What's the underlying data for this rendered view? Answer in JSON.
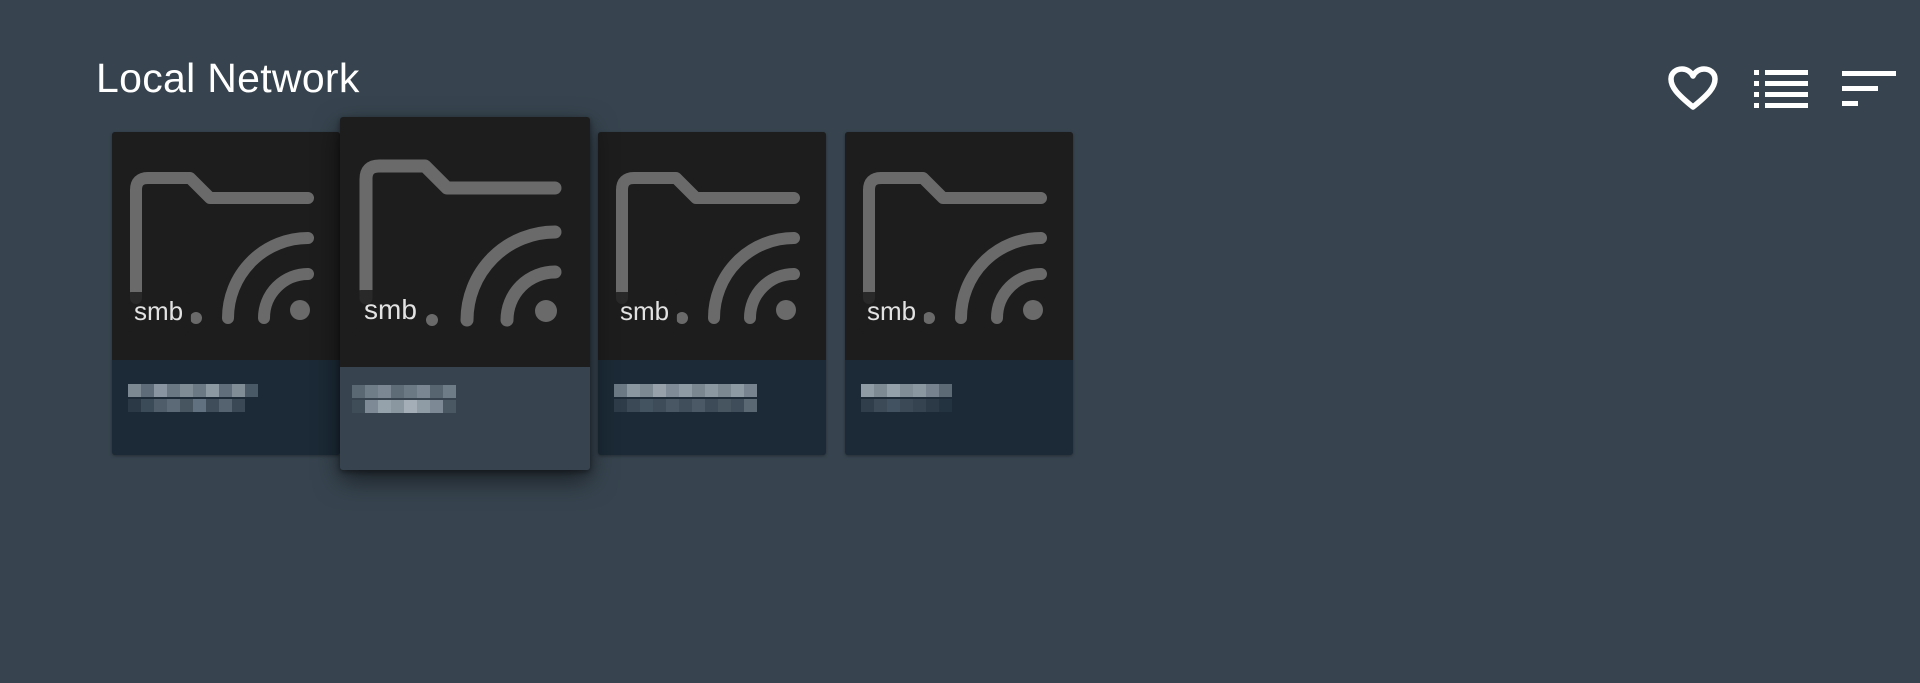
{
  "page": {
    "title": "Local Network"
  },
  "toolbar": {
    "buttons": [
      {
        "icon": "heart-icon",
        "label": "Favorites"
      },
      {
        "icon": "list-view-icon",
        "label": "List view"
      },
      {
        "icon": "sort-icon",
        "label": "Sort"
      }
    ]
  },
  "shares": [
    {
      "protocol": "smb",
      "icon": "network-folder-icon",
      "name_redacted": true
    },
    {
      "protocol": "smb",
      "icon": "network-folder-icon",
      "name_redacted": true,
      "focused": true
    },
    {
      "protocol": "smb",
      "icon": "network-folder-icon",
      "name_redacted": true
    },
    {
      "protocol": "smb",
      "icon": "network-folder-icon",
      "name_redacted": true
    }
  ],
  "colors": {
    "background": "#37444f",
    "thumbnail": "#1d1d1d",
    "caption": "#1b2a36",
    "focused_caption": "#37444f",
    "icon_gray": "#6a6a6a",
    "text": "#ffffff"
  }
}
